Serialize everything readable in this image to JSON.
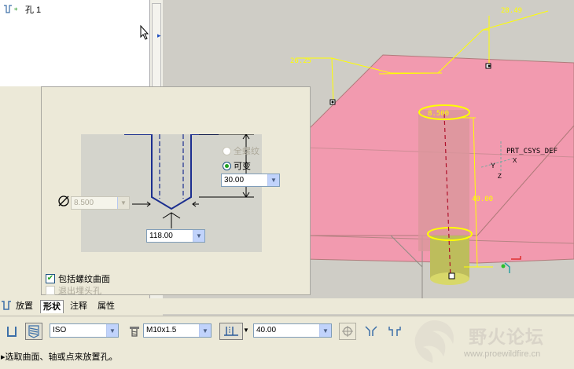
{
  "tree": {
    "item_label": "孔 1"
  },
  "viewport": {
    "dimensions": {
      "d1": "28.49",
      "d2": "26.25",
      "diameter": "8.500",
      "depth": "40.00"
    },
    "csys_label": "PRT_CSYS_DEF",
    "axis_y": "Y",
    "axis_x": "X",
    "axis_z": "Z",
    "colors": {
      "surface": "#f29aaf",
      "highlight": "#ffff00",
      "hole_shaft": "#d9969b"
    }
  },
  "shape_panel": {
    "diameter_value": "8.500",
    "angle_value": "118.00",
    "depth_value": "30.00",
    "option_full_thread": "全螺纹",
    "option_variable": "可变",
    "include_thread_surface": "包括螺纹曲面",
    "exit_countersink": "退出埋头孔"
  },
  "tabs": [
    "放置",
    "形状",
    "注释",
    "属性"
  ],
  "toolbar": {
    "standard": "ISO",
    "screw_size": "M10x1.5",
    "depth": "40.00"
  },
  "status": {
    "message": "选取曲面、轴或点来放置孔。"
  },
  "watermark": {
    "title": "野火论坛",
    "url": "www.proewildfire.cn"
  }
}
